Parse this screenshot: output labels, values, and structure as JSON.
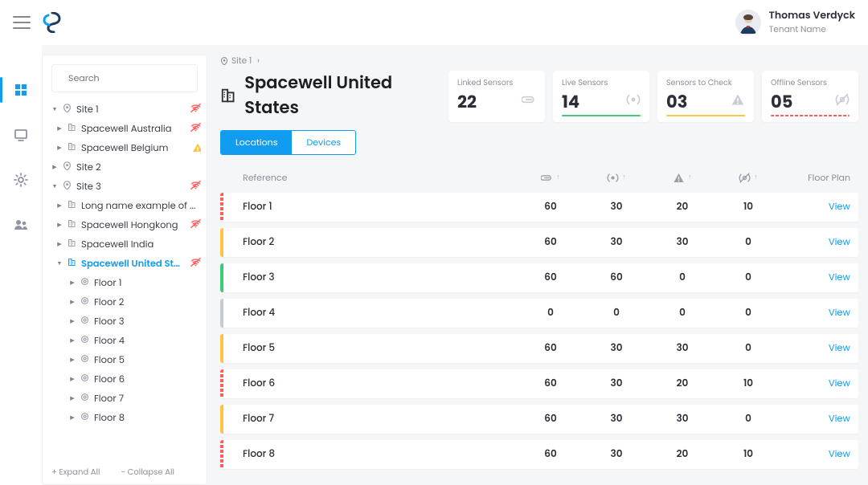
{
  "user": {
    "name": "Thomas Verdyck",
    "tenant": "Tenant Name"
  },
  "search": {
    "placeholder": "Search"
  },
  "footer": {
    "expand": "+ Expand All",
    "collapse": "- Collapse All"
  },
  "crumb": {
    "site": "Site 1"
  },
  "title": "Spacewell United States",
  "tabs": {
    "active": "Locations",
    "other": "Devices"
  },
  "cards": [
    {
      "label": "Linked Sensors",
      "value": "22",
      "icon": "link",
      "accent": "blue"
    },
    {
      "label": "Live Sensors",
      "value": "14",
      "icon": "live",
      "accent": "green"
    },
    {
      "label": "Sensors to Check",
      "value": "03",
      "icon": "warn",
      "accent": "yellow"
    },
    {
      "label": "Offline Sensors",
      "value": "05",
      "icon": "offline",
      "accent": "red"
    }
  ],
  "thead": {
    "ref": "Reference",
    "fp": "Floor Plan"
  },
  "tree": {
    "sites": [
      {
        "label": "Site 1",
        "open": true,
        "status": "red",
        "children": [
          {
            "label": "Spacewell Australia",
            "status": "red"
          },
          {
            "label": "Spacewell Belgium",
            "status": "yellow"
          }
        ]
      },
      {
        "label": "Site 2",
        "open": false,
        "status": null
      },
      {
        "label": "Site 3",
        "open": true,
        "status": "red",
        "children": [
          {
            "label": "Long name example of ...",
            "status": null
          },
          {
            "label": "Spacewell Hongkong",
            "status": "red"
          },
          {
            "label": "Spacewell India",
            "status": null
          },
          {
            "label": "Spacewell United States",
            "status": "red",
            "active": true,
            "open": true,
            "floors": [
              "Floor 1",
              "Floor 2",
              "Floor 3",
              "Floor 4",
              "Floor 5",
              "Floor 6",
              "Floor 7",
              "Floor 8"
            ]
          }
        ]
      }
    ]
  },
  "rows": [
    {
      "ref": "Floor 1",
      "stripe": "red",
      "linked": 60,
      "live": 30,
      "check": 20,
      "offline": 10,
      "view": "View"
    },
    {
      "ref": "Floor 2",
      "stripe": "yellow",
      "linked": 60,
      "live": 30,
      "check": 30,
      "offline": 0,
      "view": "View"
    },
    {
      "ref": "Floor 3",
      "stripe": "green",
      "linked": 60,
      "live": 60,
      "check": 0,
      "offline": 0,
      "view": "View"
    },
    {
      "ref": "Floor 4",
      "stripe": "gray",
      "linked": 0,
      "live": 0,
      "check": 0,
      "offline": 0,
      "view": "View"
    },
    {
      "ref": "Floor 5",
      "stripe": "yellow",
      "linked": 60,
      "live": 30,
      "check": 30,
      "offline": 0,
      "view": "View"
    },
    {
      "ref": "Floor 6",
      "stripe": "red",
      "linked": 60,
      "live": 30,
      "check": 20,
      "offline": 10,
      "view": "View"
    },
    {
      "ref": "Floor 7",
      "stripe": "yellow",
      "linked": 60,
      "live": 30,
      "check": 30,
      "offline": 0,
      "view": "View"
    },
    {
      "ref": "Floor 8",
      "stripe": "red",
      "linked": 60,
      "live": 30,
      "check": 20,
      "offline": 10,
      "view": "View"
    }
  ]
}
